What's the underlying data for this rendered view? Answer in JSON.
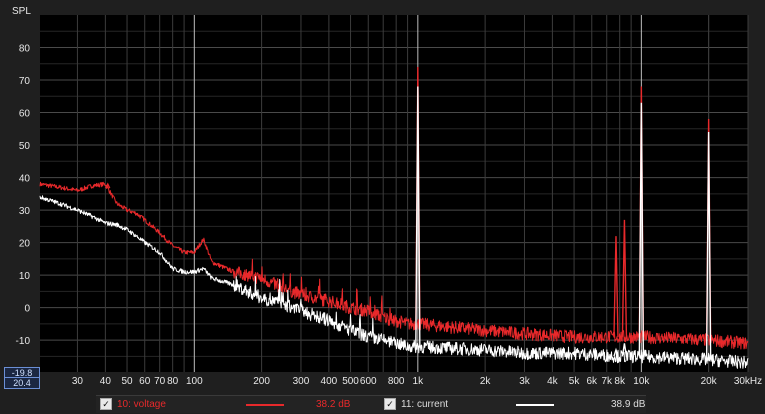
{
  "chart_data": {
    "type": "line",
    "ylabel": "SPL",
    "xunit": "Hz",
    "xscale": "log",
    "xlim": [
      20.4,
      30000
    ],
    "ylim": [
      -19.8,
      90
    ],
    "grid": true,
    "yticks": [
      80,
      70,
      60,
      50,
      40,
      30,
      20,
      10,
      0,
      -10
    ],
    "xticks": [
      {
        "v": 30,
        "label": "30"
      },
      {
        "v": 40,
        "label": "40"
      },
      {
        "v": 50,
        "label": "50"
      },
      {
        "v": 60,
        "label": "60"
      },
      {
        "v": 70,
        "label": "70"
      },
      {
        "v": 80,
        "label": "80"
      },
      {
        "v": 100,
        "label": "100"
      },
      {
        "v": 200,
        "label": "200"
      },
      {
        "v": 300,
        "label": "300"
      },
      {
        "v": 400,
        "label": "400"
      },
      {
        "v": 500,
        "label": "500"
      },
      {
        "v": 600,
        "label": "600"
      },
      {
        "v": 800,
        "label": "800"
      },
      {
        "v": 1000,
        "label": "1k"
      },
      {
        "v": 2000,
        "label": "2k"
      },
      {
        "v": 3000,
        "label": "3k"
      },
      {
        "v": 4000,
        "label": "4k"
      },
      {
        "v": 5000,
        "label": "5k"
      },
      {
        "v": 6000,
        "label": "6k"
      },
      {
        "v": 7000,
        "label": "7k"
      },
      {
        "v": 8000,
        "label": "8k"
      },
      {
        "v": 10000,
        "label": "10k"
      },
      {
        "v": 20000,
        "label": "20k"
      },
      {
        "v": 30000,
        "label": "30kHz"
      }
    ],
    "series": [
      {
        "name": "10: voltage",
        "color": "#e8292b",
        "points": [
          [
            20.4,
            38
          ],
          [
            25,
            37
          ],
          [
            30,
            36
          ],
          [
            35,
            37.5
          ],
          [
            40,
            38
          ],
          [
            45,
            32
          ],
          [
            50,
            30
          ],
          [
            55,
            29
          ],
          [
            60,
            27
          ],
          [
            70,
            23
          ],
          [
            80,
            19
          ],
          [
            90,
            17
          ],
          [
            100,
            17
          ],
          [
            110,
            21
          ],
          [
            120,
            14
          ],
          [
            150,
            11
          ],
          [
            200,
            9
          ],
          [
            250,
            6
          ],
          [
            300,
            4
          ],
          [
            400,
            2
          ],
          [
            500,
            0
          ],
          [
            600,
            -1
          ],
          [
            700,
            -3
          ],
          [
            800,
            -4
          ],
          [
            900,
            -5
          ],
          [
            1000,
            -5
          ],
          [
            2000,
            -7
          ],
          [
            3000,
            -8
          ],
          [
            5000,
            -9
          ],
          [
            8000,
            -9
          ],
          [
            10000,
            -9
          ],
          [
            20000,
            -10
          ],
          [
            30000,
            -11
          ]
        ],
        "peaks": [
          [
            41,
            38
          ],
          [
            1000,
            74
          ],
          [
            10000,
            68
          ],
          [
            20000,
            58
          ],
          [
            8400,
            27
          ],
          [
            7700,
            22
          ]
        ]
      },
      {
        "name": "11: current",
        "color": "#ffffff",
        "points": [
          [
            20.4,
            34
          ],
          [
            25,
            32
          ],
          [
            30,
            30
          ],
          [
            35,
            28
          ],
          [
            40,
            26
          ],
          [
            45,
            25.5
          ],
          [
            50,
            24
          ],
          [
            55,
            22
          ],
          [
            60,
            20
          ],
          [
            70,
            17
          ],
          [
            80,
            12
          ],
          [
            90,
            11
          ],
          [
            100,
            11
          ],
          [
            110,
            12
          ],
          [
            120,
            9
          ],
          [
            150,
            7
          ],
          [
            200,
            3
          ],
          [
            250,
            1
          ],
          [
            300,
            -1
          ],
          [
            400,
            -4
          ],
          [
            500,
            -7
          ],
          [
            600,
            -9
          ],
          [
            700,
            -10
          ],
          [
            800,
            -11
          ],
          [
            900,
            -12
          ],
          [
            1000,
            -12
          ],
          [
            2000,
            -13
          ],
          [
            3000,
            -14
          ],
          [
            5000,
            -14
          ],
          [
            8000,
            -15
          ],
          [
            10000,
            -15
          ],
          [
            20000,
            -16
          ],
          [
            30000,
            -17
          ]
        ],
        "peaks": [
          [
            1000,
            68
          ],
          [
            10000,
            63
          ],
          [
            20000,
            54
          ],
          [
            8400,
            -11
          ],
          [
            7700,
            -13
          ]
        ]
      }
    ],
    "legend": [
      {
        "name": "10: voltage",
        "value": "38.2 dB",
        "color": "#e8292b"
      },
      {
        "name": "11: current",
        "value": "38.9 dB",
        "color": "#ffffff"
      }
    ],
    "cursor": {
      "ymin_label": "-19.8",
      "xmin_label": "20.4"
    }
  }
}
